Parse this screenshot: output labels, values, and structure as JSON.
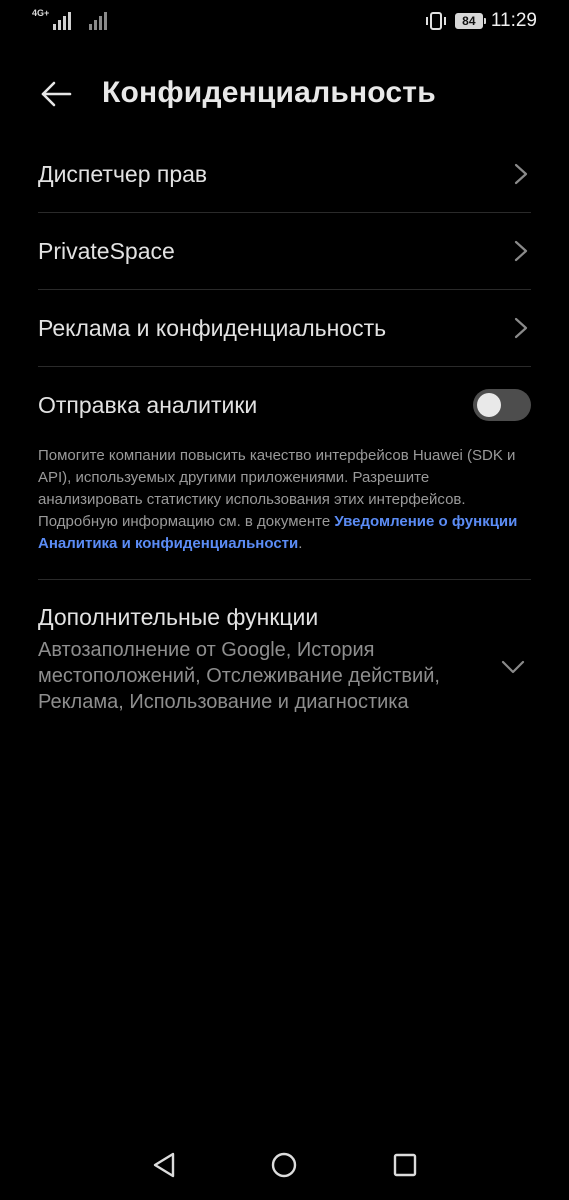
{
  "status_bar": {
    "network_label": "4G+",
    "battery_level": "84",
    "time": "11:29"
  },
  "header": {
    "title": "Конфиденциальность",
    "back_icon": "arrow-left-icon"
  },
  "list": {
    "items": [
      {
        "label": "Диспетчер прав"
      },
      {
        "label": "PrivateSpace"
      },
      {
        "label": "Реклама и конфиденциальность"
      }
    ]
  },
  "analytics": {
    "label": "Отправка аналитики",
    "toggle_on": false,
    "description": "Помогите компании повысить качество интерфейсов Huawei (SDK и API), используемых другими приложениями. Разрешите анализировать статистику использования этих интерфейсов. Подробную информацию см. в документе ",
    "link_text": "Уведомление о функции Аналитика и конфиденциальности",
    "description_end": "."
  },
  "extra": {
    "title": "Дополнительные функции",
    "subtitle": "Автозаполнение от Google, История местоположений, Отслеживание действий, Реклама, Использование и диагностика"
  },
  "colors": {
    "background": "#000000",
    "link": "#5b8cf5",
    "divider": "#2a2a2a",
    "toggle_off": "#4d4d4d"
  }
}
